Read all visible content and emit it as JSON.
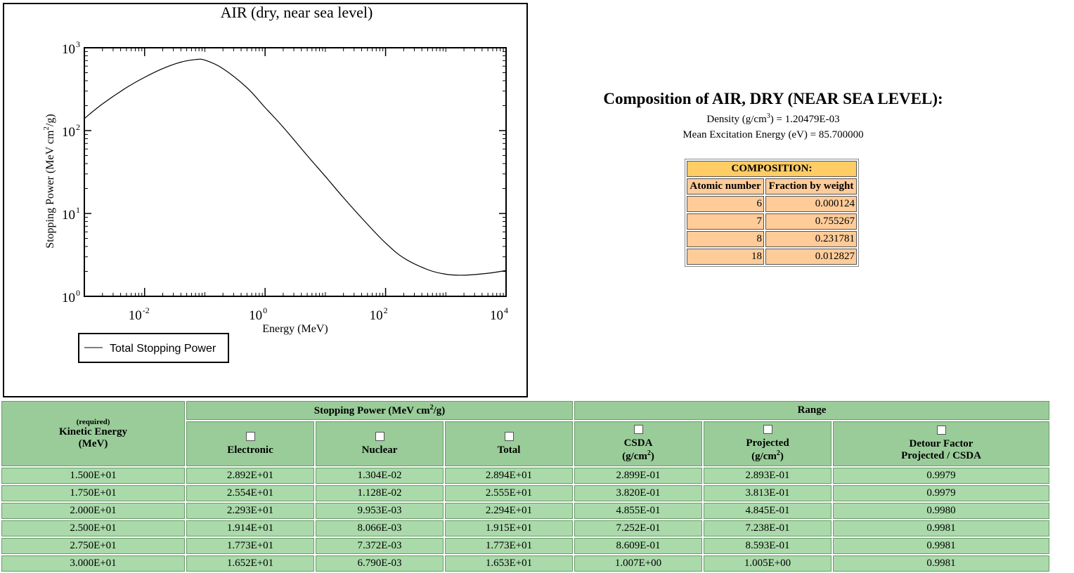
{
  "chart_data": {
    "type": "line",
    "title": "AIR (dry, near sea level)",
    "xlabel": "Energy (MeV)",
    "ylabel_parts": [
      "Stopping Power (MeV cm",
      "2",
      "/g)"
    ],
    "xscale": "log",
    "yscale": "log",
    "xlim": [
      0.001,
      10000
    ],
    "ylim": [
      1,
      1000
    ],
    "x_ticks": [
      {
        "base": "10",
        "exp": "-2"
      },
      {
        "base": "10",
        "exp": "0"
      },
      {
        "base": "10",
        "exp": "2"
      },
      {
        "base": "10",
        "exp": "4"
      }
    ],
    "y_ticks": [
      {
        "base": "10",
        "exp": "0"
      },
      {
        "base": "10",
        "exp": "1"
      },
      {
        "base": "10",
        "exp": "2"
      },
      {
        "base": "10",
        "exp": "3"
      }
    ],
    "legend": "bottom-left outside",
    "series": [
      {
        "name": "Total Stopping Power",
        "color": "#000000",
        "x": [
          0.001,
          0.002,
          0.005,
          0.01,
          0.02,
          0.04,
          0.07,
          0.1,
          0.2,
          0.5,
          1,
          2,
          5,
          10,
          20,
          50,
          100,
          200,
          500,
          1000,
          2000,
          5000,
          10000
        ],
        "y": [
          140,
          210,
          330,
          440,
          560,
          670,
          720,
          710,
          560,
          330,
          190,
          110,
          50,
          28,
          15.5,
          7.4,
          4.4,
          2.9,
          2.1,
          1.85,
          1.8,
          1.9,
          2.05
        ]
      }
    ]
  },
  "composition": {
    "title": "Composition of AIR, DRY (NEAR SEA LEVEL):",
    "density_label": "Density (g/cm",
    "density_exp": "3",
    "density_value": ") = 1.20479E-03",
    "mean_excitation": "Mean Excitation Energy (eV) = 85.700000",
    "table_title": "COMPOSITION:",
    "col_atomic": "Atomic number",
    "col_fraction": "Fraction by weight",
    "rows": [
      {
        "z": "6",
        "fraction": "0.000124"
      },
      {
        "z": "7",
        "fraction": "0.755267"
      },
      {
        "z": "8",
        "fraction": "0.231781"
      },
      {
        "z": "18",
        "fraction": "0.012827"
      }
    ]
  },
  "data_table": {
    "required_label": "(required)",
    "kinetic_label_1": "Kinetic Energy",
    "kinetic_label_2": "(MeV)",
    "stopping_group_a": "Stopping Power (MeV cm",
    "stopping_group_exp": "2",
    "stopping_group_b": "/g)",
    "range_group": "Range",
    "col_electronic": "Electronic",
    "col_nuclear": "Nuclear",
    "col_total": "Total",
    "col_csda": "CSDA",
    "col_projected": "Projected",
    "unit_gcm_a": "(g/cm",
    "unit_gcm_exp": "2",
    "unit_gcm_b": ")",
    "col_detour_1": "Detour Factor",
    "col_detour_2": "Projected / CSDA",
    "rows": [
      [
        "1.500E+01",
        "2.892E+01",
        "1.304E-02",
        "2.894E+01",
        "2.899E-01",
        "2.893E-01",
        "0.9979"
      ],
      [
        "1.750E+01",
        "2.554E+01",
        "1.128E-02",
        "2.555E+01",
        "3.820E-01",
        "3.813E-01",
        "0.9979"
      ],
      [
        "2.000E+01",
        "2.293E+01",
        "9.953E-03",
        "2.294E+01",
        "4.855E-01",
        "4.845E-01",
        "0.9980"
      ],
      [
        "2.500E+01",
        "1.914E+01",
        "8.066E-03",
        "1.915E+01",
        "7.252E-01",
        "7.238E-01",
        "0.9981"
      ],
      [
        "2.750E+01",
        "1.773E+01",
        "7.372E-03",
        "1.773E+01",
        "8.609E-01",
        "8.593E-01",
        "0.9981"
      ],
      [
        "3.000E+01",
        "1.652E+01",
        "6.790E-03",
        "1.653E+01",
        "1.007E+00",
        "1.005E+00",
        "0.9981"
      ]
    ]
  }
}
